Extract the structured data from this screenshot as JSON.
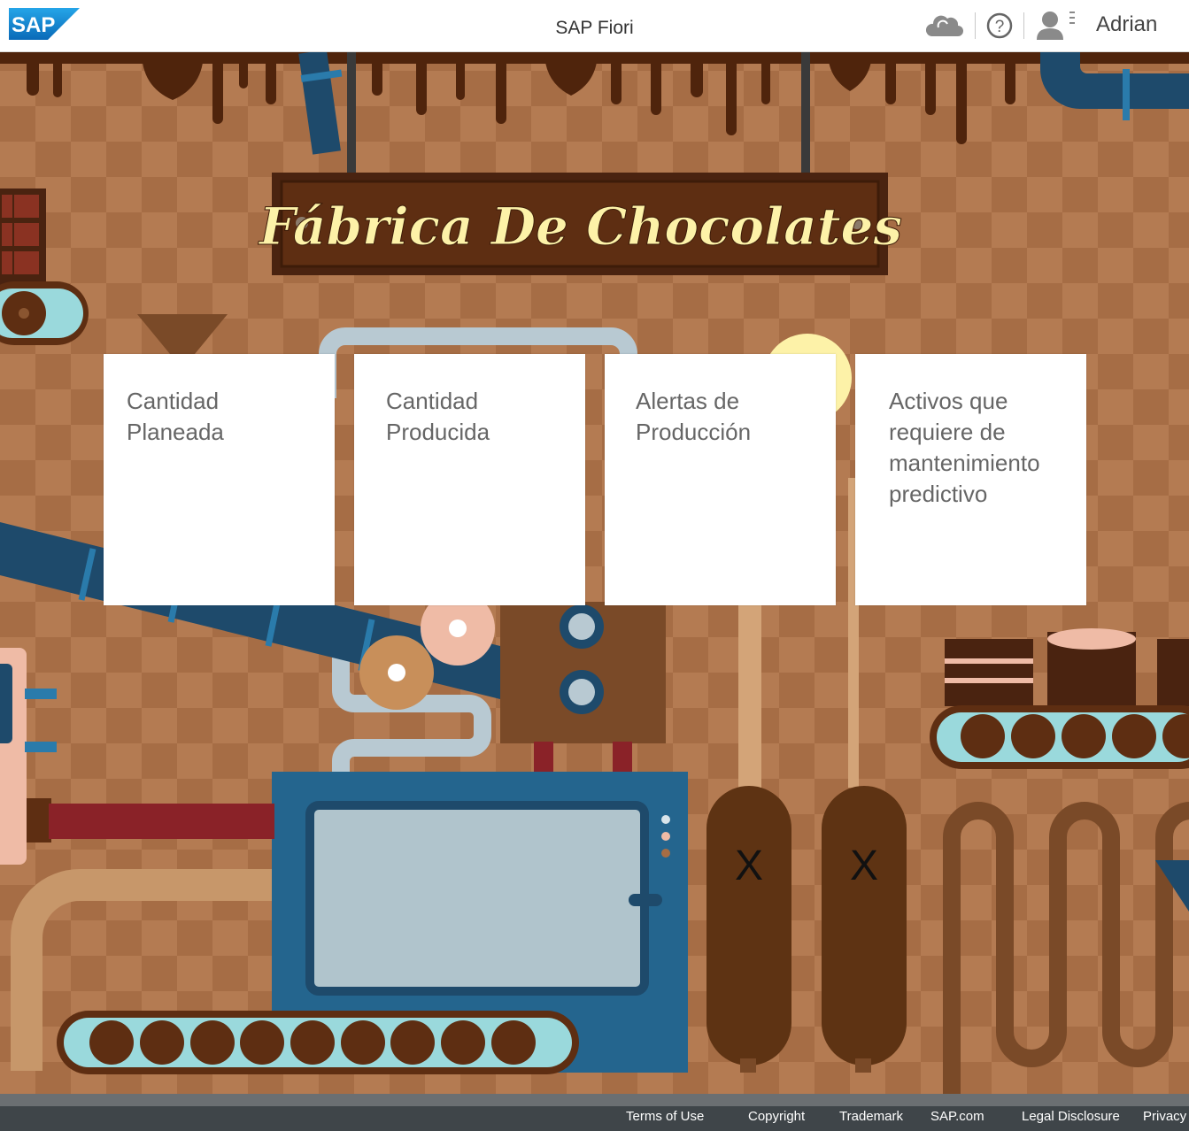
{
  "shell": {
    "logo_text": "SAP",
    "title": "SAP Fiori",
    "user_name": "Adrian"
  },
  "banner": {
    "title": "Fábrica De Chocolates"
  },
  "tiles": [
    {
      "title": "Cantidad Planeada"
    },
    {
      "title": "Cantidad Producida"
    },
    {
      "title": "Alertas de Producción"
    },
    {
      "title": "Activos que requiere de mantenimiento predictivo"
    }
  ],
  "tanks": [
    {
      "label": "X"
    },
    {
      "label": "X"
    }
  ],
  "footer": {
    "links": [
      "Terms of Use",
      "Copyright",
      "Trademark",
      "SAP.com",
      "Legal Disclosure",
      "Privacy"
    ]
  },
  "icons": {
    "cloud": "cloud-icon",
    "help": "help-icon",
    "user": "user-icon"
  },
  "colors": {
    "brand_blue": "#1a82cf",
    "background": "#a87048",
    "chocolate_dark": "#4a2310",
    "banner_text": "#fdf2a8"
  }
}
